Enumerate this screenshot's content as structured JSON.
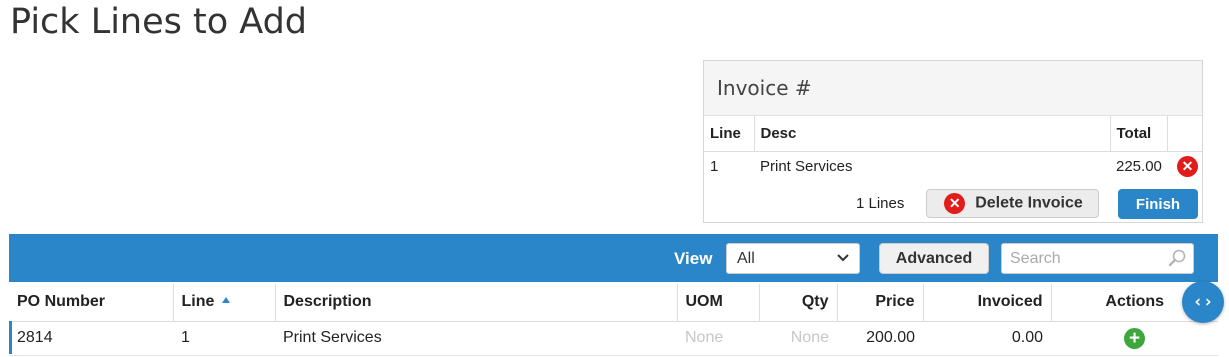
{
  "page": {
    "title": "Pick Lines to Add"
  },
  "invoice": {
    "title": "Invoice #",
    "columns": {
      "line": "Line",
      "desc": "Desc",
      "total": "Total"
    },
    "rows": [
      {
        "line": "1",
        "desc": "Print Services",
        "total": "225.00"
      }
    ],
    "lines_count": "1 Lines",
    "delete_label": "Delete Invoice",
    "finish_label": "Finish"
  },
  "toolbar": {
    "view_label": "View",
    "view_selected": "All",
    "advanced_label": "Advanced",
    "search_placeholder": "Search"
  },
  "table": {
    "columns": {
      "po_number": "PO Number",
      "line": "Line",
      "description": "Description",
      "uom": "UOM",
      "qty": "Qty",
      "price": "Price",
      "invoiced": "Invoiced",
      "actions": "Actions"
    },
    "rows": [
      {
        "po_number": "2814",
        "line": "1",
        "description": "Print Services",
        "uom": "None",
        "qty": "None",
        "price": "200.00",
        "invoiced": "0.00"
      }
    ]
  },
  "icons": {
    "remove": "x-circle-icon",
    "add": "plus-circle-icon",
    "search": "search-icon",
    "sort": "sort-asc-icon",
    "toggle": "code-toggle-icon"
  },
  "colors": {
    "accent": "#2a86c9",
    "danger": "#e21b1b",
    "success": "#3da63d"
  }
}
